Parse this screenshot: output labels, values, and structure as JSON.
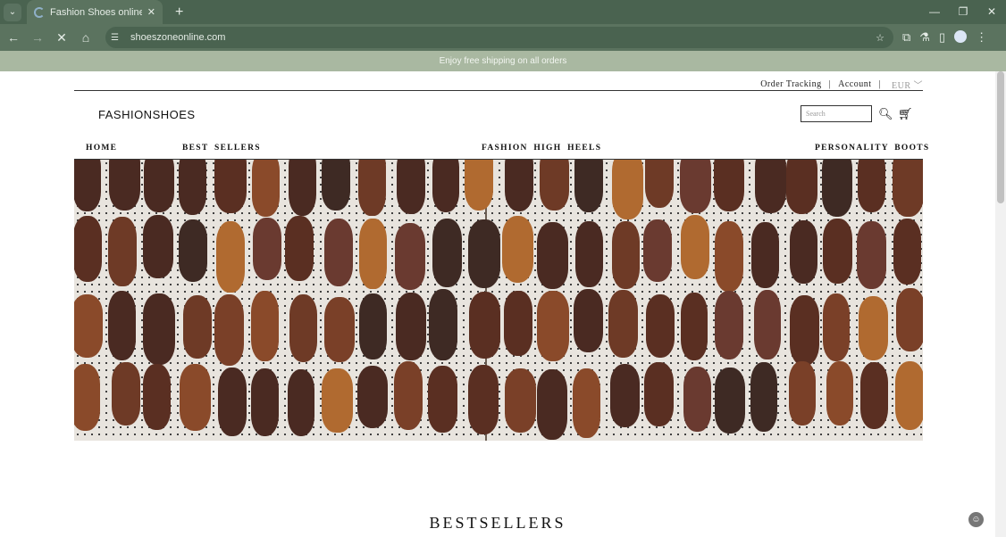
{
  "browser": {
    "tab_title": "Fashion Shoes online store, the",
    "url": "shoeszoneonline.com",
    "colors": {
      "frame": "#4a6350",
      "toolbar": "#5b735f"
    }
  },
  "announcement": "Enjoy free shipping on all orders",
  "header": {
    "order_tracking": "Order Tracking",
    "account": "Account",
    "currency": "EUR",
    "logo": "FASHIONSHOES",
    "search_placeholder": "Search"
  },
  "menu": [
    {
      "label": "HOME"
    },
    {
      "label": "BEST SELLERS"
    },
    {
      "label": "FASHION HIGH HEELS"
    },
    {
      "label": "PERSONALITY BOOTS"
    }
  ],
  "section_title": "BESTSELLERS"
}
